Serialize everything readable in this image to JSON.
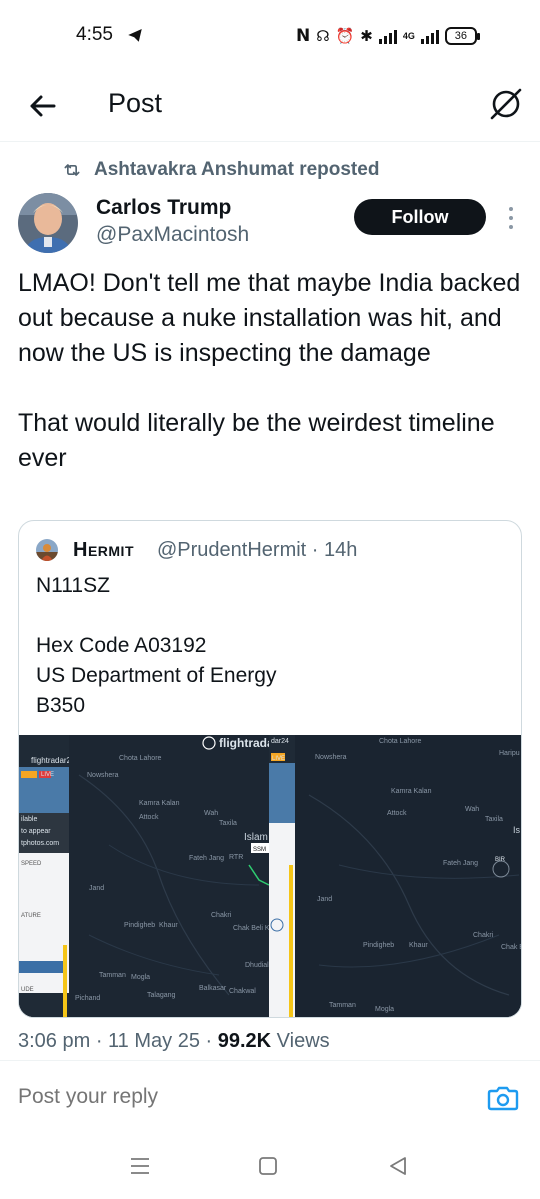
{
  "status_bar": {
    "time": "4:55",
    "battery": "36",
    "network": "4G"
  },
  "header": {
    "title": "Post"
  },
  "repost": {
    "text": "Ashtavakra Anshumat reposted"
  },
  "author": {
    "name": "Carlos Trump",
    "handle": "@PaxMacintosh",
    "follow_label": "Follow"
  },
  "post": {
    "text": "LMAO! Don't tell me that maybe India backed out because a nuke installation was hit, and now the US is inspecting the damage\n\nThat would literally be the weirdest timeline ever"
  },
  "quote": {
    "name": "Hermit",
    "handle_time": "@PrudentHermit · 14h",
    "text": "N111SZ\n\nHex Code A03192\nUS Department of Energy\nB350",
    "image_labels": {
      "brand": "flightradar24",
      "brand_left": "flightradar24",
      "brand_right": "dar24",
      "live": "LIVE",
      "speed": "SPEED",
      "ature": "ATURE",
      "ude": "UDE",
      "ilable": "ilable",
      "to_appear": "to appear",
      "tphotos": "tphotos.com",
      "islam": "Islam",
      "islam_right": "Is",
      "attock": "Attock",
      "wah": "Wah",
      "taxila": "Taxila",
      "fateh_jang": "Fateh Jang",
      "jand": "Jand",
      "pindigheb": "Pindigheb",
      "khaur": "Khaur",
      "chakri": "Chakri",
      "chak_beli_khan": "Chak Beli Khan",
      "kamra_kalan": "Kamra Kalan",
      "nowshera": "Nowshera",
      "tamman": "Tamman",
      "mogla": "Mogla",
      "talagang": "Talagang",
      "balkasar": "Balkasar",
      "chakwal": "Chakwal",
      "dhudial": "Dhudial",
      "pichand": "Pichand",
      "charsadda_lahore": "Chota Lahore",
      "haripur": "Haripu",
      "ssm": "SSM",
      "bir": "BIR",
      "rtr": "RTR"
    }
  },
  "meta": {
    "time_date": "3:06 pm · 11 May 25 · ",
    "views_count": "99.2K",
    "views_label": " Views"
  },
  "reply": {
    "placeholder": "Post your reply"
  },
  "icons": {
    "back": "arrow-left-icon",
    "grok": "grok-icon",
    "repost": "repost-icon",
    "camera": "camera-icon",
    "more": "more-vertical-icon"
  },
  "colors": {
    "text_primary": "#0f1419",
    "text_secondary": "#536471",
    "accent_blue": "#1d9bf0",
    "follow_bg": "#0f1419",
    "map_bg": "#1c2530"
  }
}
